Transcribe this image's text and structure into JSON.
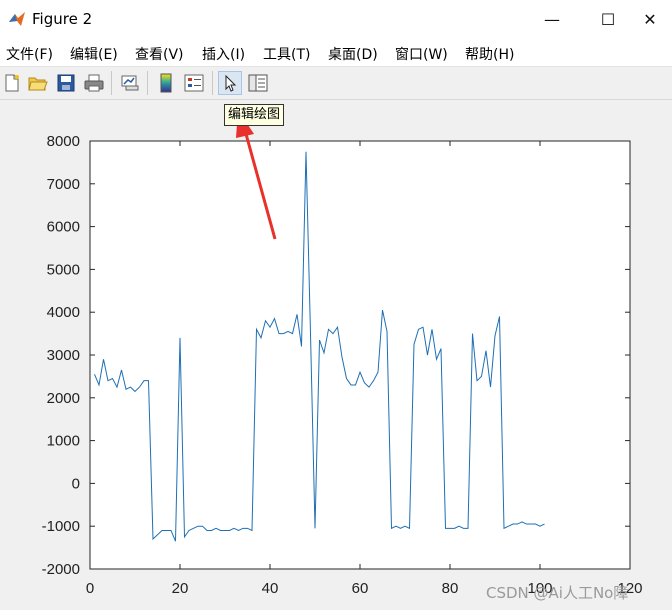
{
  "window": {
    "title": "Figure 2",
    "minimize_glyph": "—",
    "maximize_glyph": "☐",
    "close_glyph": "✕"
  },
  "menu": [
    {
      "label": "文件(F)"
    },
    {
      "label": "编辑(E)"
    },
    {
      "label": "查看(V)"
    },
    {
      "label": "插入(I)"
    },
    {
      "label": "工具(T)"
    },
    {
      "label": "桌面(D)"
    },
    {
      "label": "窗口(W)"
    },
    {
      "label": "帮助(H)"
    }
  ],
  "toolbar": {
    "icons": [
      "new-figure-icon",
      "open-folder-icon",
      "save-icon",
      "print-icon",
      "link-plot-icon",
      "insert-colorbar-icon",
      "insert-legend-icon",
      "edit-plot-arrow-icon",
      "property-inspector-icon"
    ],
    "active": "edit-plot-arrow-icon"
  },
  "tooltip": {
    "text": "编辑绘图"
  },
  "annotation": {
    "arrow_color": "#e8312b"
  },
  "watermark": {
    "text": "CSDN @Ai人工No障"
  },
  "colors": {
    "line": "#1f6fb4",
    "axes_bg": "#ffffff",
    "figure_bg": "#f0f0f0"
  },
  "chart_data": {
    "type": "line",
    "x": [
      1,
      2,
      3,
      4,
      5,
      6,
      7,
      8,
      9,
      10,
      11,
      12,
      13,
      14,
      15,
      16,
      17,
      18,
      19,
      20,
      21,
      22,
      23,
      24,
      25,
      26,
      27,
      28,
      29,
      30,
      31,
      32,
      33,
      34,
      35,
      36,
      37,
      38,
      39,
      40,
      41,
      42,
      43,
      44,
      45,
      46,
      47,
      48,
      49,
      50,
      51,
      52,
      53,
      54,
      55,
      56,
      57,
      58,
      59,
      60,
      61,
      62,
      63,
      64,
      65,
      66,
      67,
      68,
      69,
      70,
      71,
      72,
      73,
      74,
      75,
      76,
      77,
      78,
      79,
      80,
      81,
      82,
      83,
      84,
      85,
      86,
      87,
      88,
      89,
      90,
      91,
      92,
      93,
      94,
      95,
      96,
      97,
      98,
      99,
      100,
      101
    ],
    "series": [
      {
        "values": [
          2550,
          2300,
          2900,
          2400,
          2450,
          2250,
          2650,
          2200,
          2250,
          2150,
          2250,
          2400,
          2400,
          -1300,
          -1200,
          -1100,
          -1100,
          -1100,
          -1350,
          3400,
          -1250,
          -1100,
          -1050,
          -1000,
          -1000,
          -1100,
          -1100,
          -1050,
          -1100,
          -1100,
          -1100,
          -1050,
          -1100,
          -1050,
          -1050,
          -1100,
          3600,
          3400,
          3800,
          3650,
          3850,
          3500,
          3500,
          3550,
          3500,
          3950,
          3200,
          7750,
          3500,
          -1050,
          3350,
          3050,
          3600,
          3500,
          3650,
          2950,
          2450,
          2300,
          2300,
          2600,
          2350,
          2250,
          2400,
          2600,
          4050,
          3550,
          -1050,
          -1000,
          -1050,
          -1000,
          -1050,
          3250,
          3600,
          3650,
          3000,
          3600,
          2900,
          3150,
          -1050,
          -1050,
          -1050,
          -1000,
          -1050,
          -1050,
          3500,
          2400,
          2500,
          3100,
          2250,
          3450,
          3900,
          -1050,
          -1000,
          -950,
          -950,
          -900,
          -950,
          -950,
          -950,
          -1000,
          -950
        ]
      }
    ],
    "xlim": [
      0,
      120
    ],
    "ylim": [
      -2000,
      8000
    ],
    "xticks": [
      0,
      20,
      40,
      60,
      80,
      100,
      120
    ],
    "yticks": [
      -2000,
      -1000,
      0,
      1000,
      2000,
      3000,
      4000,
      5000,
      6000,
      7000,
      8000
    ],
    "grid": false
  }
}
